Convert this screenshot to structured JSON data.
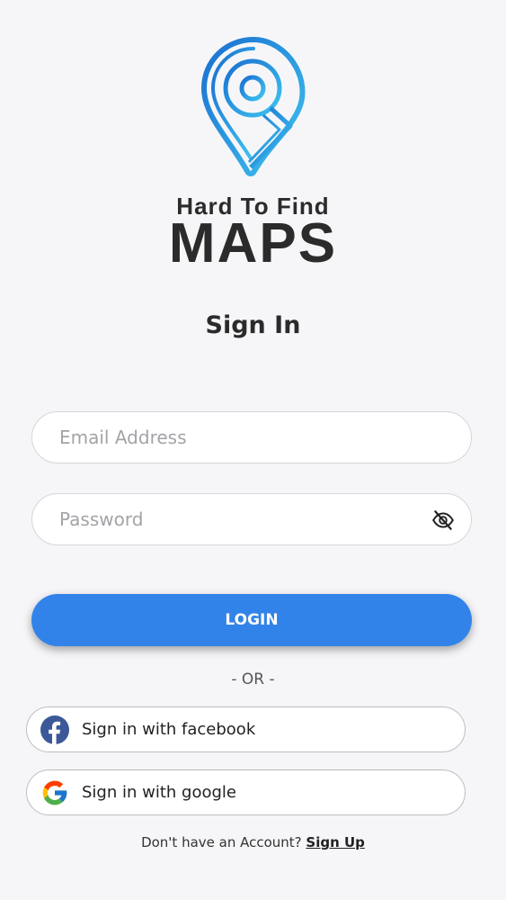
{
  "brand": {
    "line1": "Hard To Find",
    "line2": "MAPS",
    "pin_color_light": "#3fc4f0",
    "pin_color_dark": "#1a6fd0"
  },
  "screen_title": "Sign In",
  "email": {
    "placeholder": "Email Address",
    "value": ""
  },
  "password": {
    "placeholder": "Password",
    "value": "",
    "toggle_icon": "eye-off-icon"
  },
  "login": {
    "label": "LOGIN",
    "color": "#3283e9"
  },
  "divider": "- OR -",
  "social": {
    "facebook": {
      "label": "Sign in with facebook",
      "icon": "facebook-icon",
      "color": "#3b5998"
    },
    "google": {
      "label": "Sign in with google",
      "icon": "google-icon"
    }
  },
  "signup": {
    "prompt": "Don't have an Account? ",
    "link": "Sign Up"
  }
}
